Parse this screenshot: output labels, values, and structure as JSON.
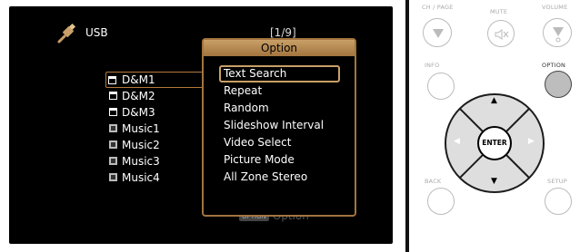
{
  "screen": {
    "source": "USB",
    "page_counter": "[1/9]",
    "files": [
      {
        "name": "D&M1",
        "type": "folder",
        "selected": true
      },
      {
        "name": "D&M2",
        "type": "folder",
        "selected": false
      },
      {
        "name": "D&M3",
        "type": "folder",
        "selected": false
      },
      {
        "name": "Music1",
        "type": "music",
        "selected": false
      },
      {
        "name": "Music2",
        "type": "music",
        "selected": false
      },
      {
        "name": "Music3",
        "type": "music",
        "selected": false
      },
      {
        "name": "Music4",
        "type": "music",
        "selected": false
      }
    ],
    "option_hint": {
      "key": "OPTION",
      "label": "Option"
    },
    "popup": {
      "title": "Option",
      "items": [
        "Text Search",
        "Repeat",
        "Random",
        "Slideshow Interval",
        "Video Select",
        "Picture Mode",
        "All Zone Stereo"
      ],
      "selected_index": 0
    }
  },
  "remote": {
    "labels": {
      "ch_page": "CH / PAGE",
      "mute": "MUTE",
      "volume": "VOLUME",
      "info": "INFO",
      "option": "OPTION",
      "back": "BACK",
      "setup": "SETUP",
      "enter": "ENTER"
    },
    "icons": {
      "ch_down": "triangle-down-icon",
      "mute": "speaker-mute-icon",
      "vol_down": "triangle-down-icon"
    },
    "active_button": "OPTION",
    "colors": {
      "popup_border": "#a2743f",
      "dpad": "#1c1c1c"
    }
  }
}
